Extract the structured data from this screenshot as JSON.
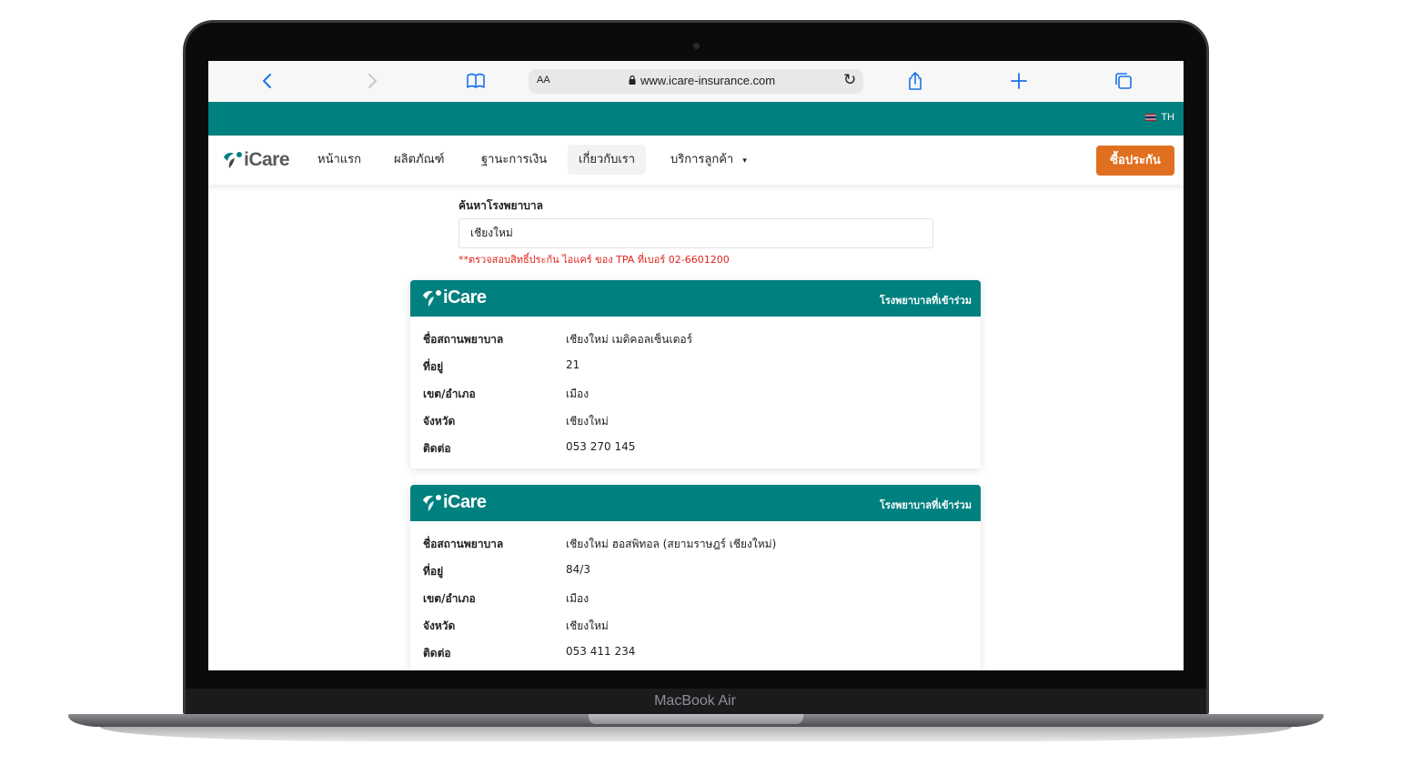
{
  "device": {
    "label": "MacBook Air"
  },
  "browser": {
    "address_aa": "AA",
    "url": "www.icare-insurance.com",
    "icons": [
      "back-icon",
      "forward-icon",
      "bookmarks-icon",
      "lock-icon",
      "reload-icon",
      "share-icon",
      "new-tab-icon",
      "tabs-icon"
    ]
  },
  "topbar": {
    "lang": "TH"
  },
  "brand": {
    "logo_text": "iCare"
  },
  "nav": {
    "items": [
      {
        "label": "หน้าแรก"
      },
      {
        "label": "ผลิตภัณฑ์"
      },
      {
        "label": "ฐานะการเงิน"
      },
      {
        "label": "เกี่ยวกับเรา"
      },
      {
        "label": "บริการลูกค้า"
      }
    ],
    "active_index": 3,
    "buy_label": "ซื้อประกัน"
  },
  "search": {
    "label": "ค้นหาโรงพยาบาล",
    "value": "เชียงใหม่",
    "note": "**ตรวจสอบสิทธิ์ประกัน ไอแคร์ ของ TPA ที่เบอร์ 02-6601200"
  },
  "cards": [
    {
      "tag": "โรงพยาบาลที่เข้าร่วม",
      "rows": [
        {
          "key": "ชื่อสถานพยาบาล",
          "value": "เชียงใหม่ เมดิคอลเซ็นเตอร์"
        },
        {
          "key": "ที่อยู่",
          "value": "21"
        },
        {
          "key": "เขต/อำเภอ",
          "value": "เมือง"
        },
        {
          "key": "จังหวัด",
          "value": "เชียงใหม่"
        },
        {
          "key": "ติดต่อ",
          "value": "053 270 145"
        }
      ]
    },
    {
      "tag": "โรงพยาบาลที่เข้าร่วม",
      "rows": [
        {
          "key": "ชื่อสถานพยาบาล",
          "value": "เชียงใหม่ ฮอสพิทอล (สยามราษฎร์ เชียงใหม่)"
        },
        {
          "key": "ที่อยู่",
          "value": "84/3"
        },
        {
          "key": "เขต/อำเภอ",
          "value": "เมือง"
        },
        {
          "key": "จังหวัด",
          "value": "เชียงใหม่"
        },
        {
          "key": "ติดต่อ",
          "value": "053 411 234"
        }
      ]
    }
  ],
  "colors": {
    "teal": "#00807f",
    "orange": "#e07020",
    "note_red": "#e0221a"
  }
}
